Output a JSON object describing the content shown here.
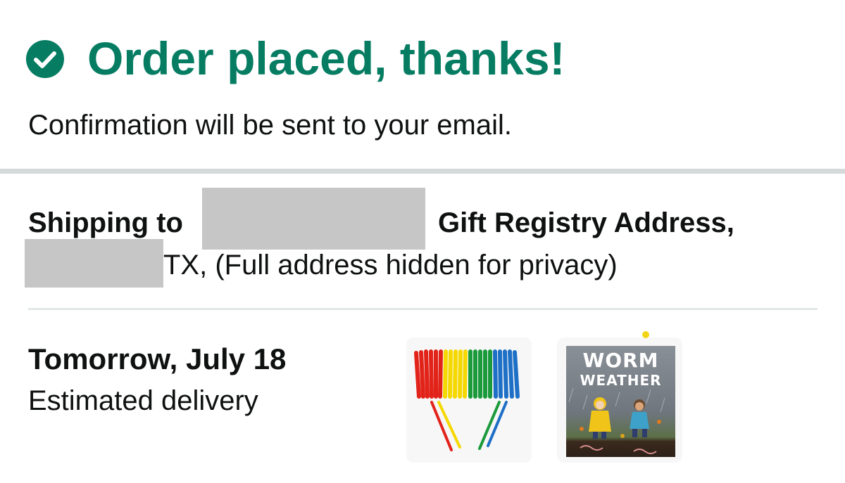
{
  "header": {
    "check_icon": "check-circle-icon",
    "title": "Order placed, thanks!",
    "subtitle": "Confirmation will be sent to your email."
  },
  "shipping": {
    "prefix": "Shipping to",
    "address_label": "Gift Registry Address,",
    "line2": "TX, (Full address hidden for privacy)"
  },
  "delivery": {
    "date": "Tomorrow, July 18",
    "label": "Estimated delivery"
  },
  "items": [
    {
      "image": "colored-straws-product-image"
    },
    {
      "image": "worm-weather-book-cover-image",
      "cover_title_1": "WORM",
      "cover_title_2": "WEATHER"
    }
  ],
  "colors": {
    "success_green": "#067d62",
    "text": "#0f1111",
    "divider": "#d5d9d9",
    "redaction": "#c6c6c6"
  }
}
